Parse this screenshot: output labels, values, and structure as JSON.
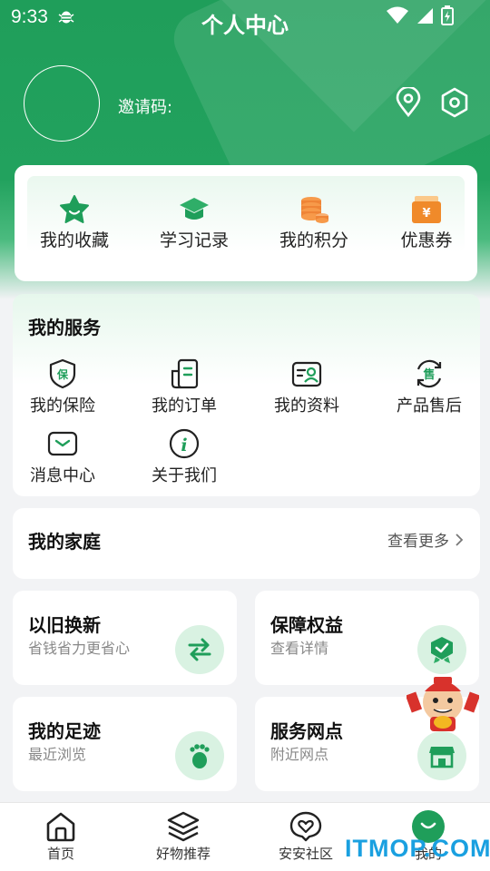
{
  "status": {
    "time": "9:33"
  },
  "header": {
    "title": "个人中心",
    "invite_label": "邀请码:"
  },
  "quick": [
    {
      "label": "我的收藏",
      "icon": "star-icon"
    },
    {
      "label": "学习记录",
      "icon": "graduation-cap-icon"
    },
    {
      "label": "我的积分",
      "icon": "coins-icon"
    },
    {
      "label": "优惠券",
      "icon": "coupon-icon",
      "symbol": "¥"
    }
  ],
  "services": {
    "title": "我的服务",
    "items": [
      {
        "label": "我的保险",
        "icon": "insurance-shield-icon",
        "symbol": "保"
      },
      {
        "label": "我的订单",
        "icon": "order-icon"
      },
      {
        "label": "我的资料",
        "icon": "profile-card-icon"
      },
      {
        "label": "产品售后",
        "icon": "after-sales-icon",
        "symbol": "售"
      },
      {
        "label": "消息中心",
        "icon": "message-icon"
      },
      {
        "label": "关于我们",
        "icon": "info-icon",
        "symbol": "i"
      }
    ]
  },
  "family": {
    "title": "我的家庭",
    "more": "查看更多"
  },
  "features": [
    {
      "title": "以旧换新",
      "subtitle": "省钱省力更省心",
      "icon": "swap-arrows-icon"
    },
    {
      "title": "保障权益",
      "subtitle": "查看详情",
      "icon": "badge-check-icon"
    },
    {
      "title": "我的足迹",
      "subtitle": "最近浏览",
      "icon": "footprint-icon"
    },
    {
      "title": "服务网点",
      "subtitle": "附近网点",
      "icon": "store-icon"
    }
  ],
  "tabs": [
    {
      "label": "首页",
      "icon": "home-icon"
    },
    {
      "label": "好物推荐",
      "icon": "layers-icon"
    },
    {
      "label": "安安社区",
      "icon": "heart-chat-icon"
    },
    {
      "label": "我的",
      "icon": "smile-icon",
      "active": true
    }
  ],
  "watermark": "ITMOP.COM",
  "colors": {
    "brand": "#1f9e5a",
    "accent_orange": "#f08a2a",
    "background": "#f2f3f5"
  }
}
